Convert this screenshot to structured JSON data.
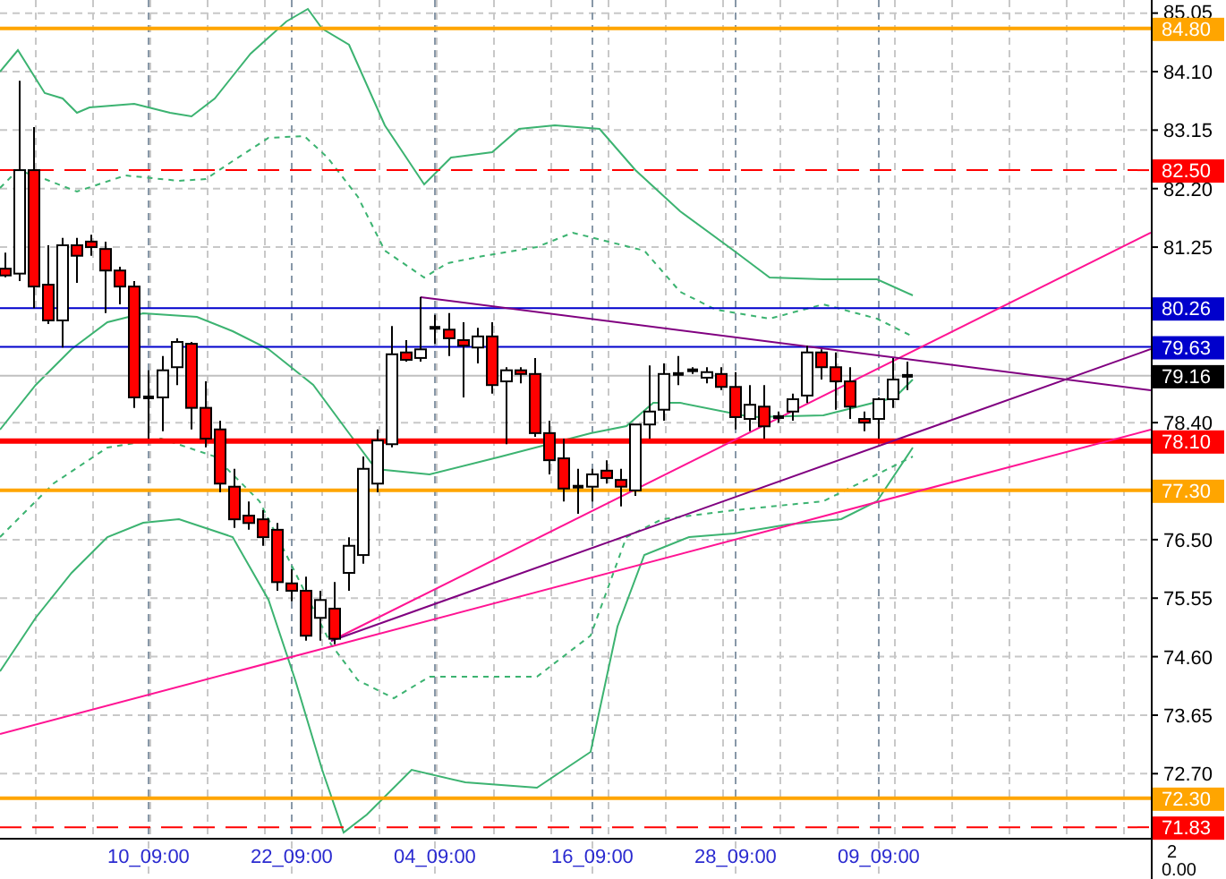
{
  "chart": {
    "price_axis": [
      "85.05",
      "84.10",
      "83.15",
      "82.20",
      "81.25",
      "78.40",
      "76.50",
      "75.55",
      "74.60",
      "73.65",
      "72.70"
    ],
    "time_axis": [
      "10_09:00",
      "22_09:00",
      "04_09:00",
      "16_09:00",
      "28_09:00",
      "09_09:00"
    ],
    "price_levels": [
      {
        "label": "84.80",
        "color": "#ffa500",
        "kind": "thick"
      },
      {
        "label": "82.50",
        "color": "#ff0000",
        "kind": "dashed"
      },
      {
        "label": "80.26",
        "color": "#0000cc",
        "kind": "solid"
      },
      {
        "label": "79.63",
        "color": "#0000cc",
        "kind": "solid"
      },
      {
        "label": "79.16",
        "color": "#000000",
        "kind": "current"
      },
      {
        "label": "78.10",
        "color": "#ff0000",
        "kind": "heavy"
      },
      {
        "label": "77.30",
        "color": "#ffa500",
        "kind": "thick"
      },
      {
        "label": "72.30",
        "color": "#ffa500",
        "kind": "thick"
      },
      {
        "label": "71.83",
        "color": "#ff0000",
        "kind": "dashed"
      }
    ]
  },
  "subwindow": {
    "axis_labels": [
      "2",
      "0.00"
    ]
  }
}
